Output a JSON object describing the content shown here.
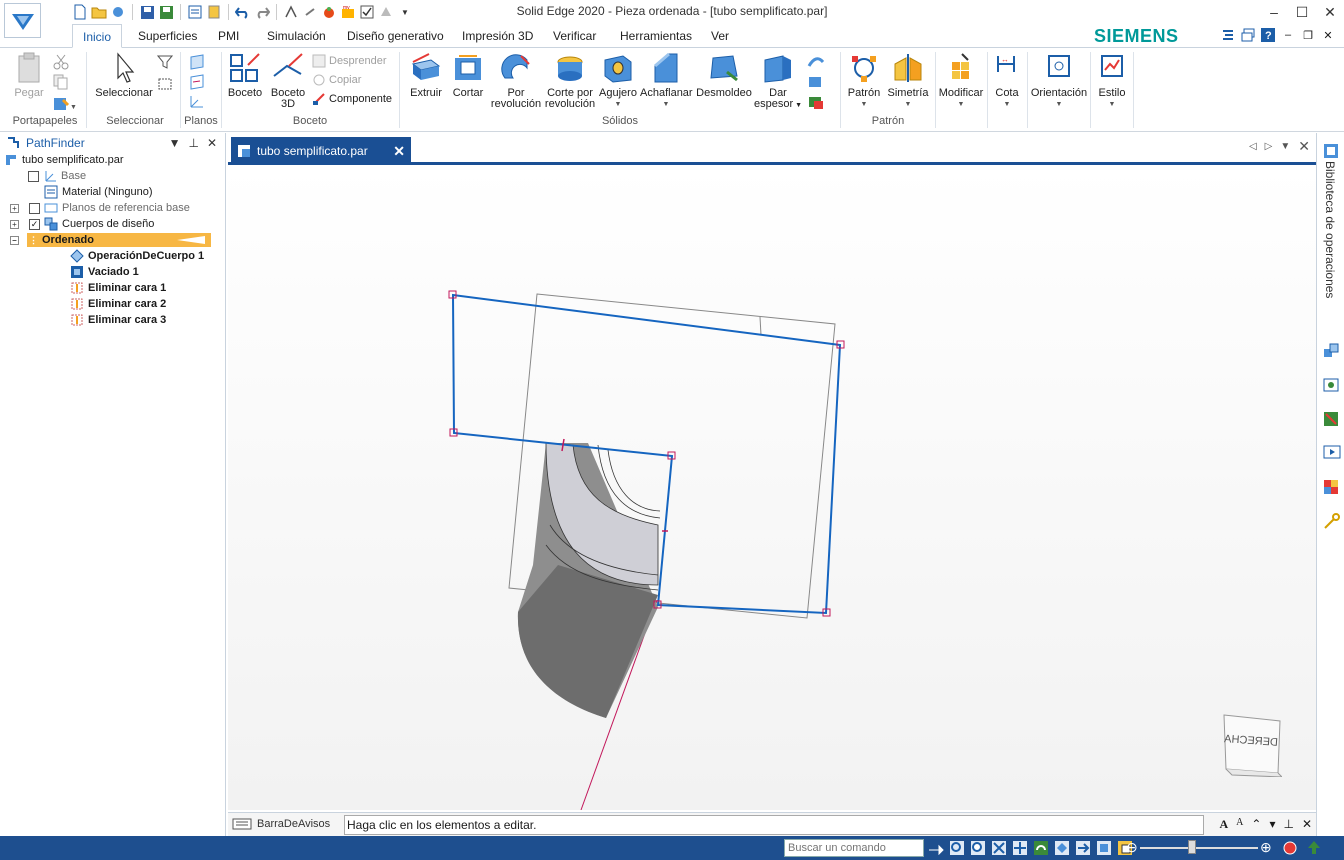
{
  "window": {
    "title": "Solid Edge 2020 - Pieza ordenada - [tubo semplificato.par]"
  },
  "ribbon_tabs": [
    "Inicio",
    "Superficies",
    "PMI",
    "Simulación",
    "Diseño generativo",
    "Impresión 3D",
    "Verificar",
    "Herramientas",
    "Ver"
  ],
  "active_tab": "Inicio",
  "brand": "SIEMENS",
  "ribbon": {
    "portapapeles": {
      "paste": "Pegar",
      "group": "Portapapeles"
    },
    "seleccionar": {
      "select": "Seleccionar",
      "group": "Seleccionar"
    },
    "planos": {
      "group": "Planos"
    },
    "boceto": {
      "sketch": "Boceto",
      "sketch3d_line1": "Boceto",
      "sketch3d_line2": "3D",
      "detach": "Desprender",
      "copy": "Copiar",
      "component": "Componente",
      "group": "Boceto"
    },
    "solidos": {
      "extrude": "Extruir",
      "cut": "Cortar",
      "revolve_line1": "Por",
      "revolve_line2": "revolución",
      "revcut_line1": "Corte por",
      "revcut_line2": "revolución",
      "hole": "Agujero",
      "chamfer": "Achaflanar",
      "draft": "Desmoldeo",
      "thicken_line1": "Dar",
      "thicken_line2": "espesor",
      "group": "Sólidos"
    },
    "patron": {
      "pattern": "Patrón",
      "mirror": "Simetría",
      "group": "Patrón"
    },
    "modify": "Modificar",
    "dimension": "Cota",
    "orientation": "Orientación",
    "style": "Estilo"
  },
  "pathfinder": {
    "title": "PathFinder",
    "root": "tubo semplificato.par",
    "items": [
      {
        "label": "Base",
        "gray": true
      },
      {
        "label": "Material (Ninguno)",
        "gray": false
      },
      {
        "label": "Planos de referencia base",
        "gray": true
      },
      {
        "label": "Cuerpos de diseño",
        "gray": false
      },
      {
        "label": "Ordenado",
        "gray": false
      }
    ],
    "features": [
      "OperaciónDeCuerpo 1",
      "Vaciado 1",
      "Eliminar cara 1",
      "Eliminar cara 2",
      "Eliminar cara 3"
    ]
  },
  "document_tab": "tubo semplificato.par",
  "right_panel_label": "Biblioteca de operaciones",
  "view_cube_label": "DERECHA",
  "infobar": {
    "label": "BarraDeAvisos",
    "message": "Haga clic en los elementos a editar."
  },
  "statusbar": {
    "search_placeholder": "Buscar un comando"
  },
  "colors": {
    "accent": "#1a4f94",
    "brand": "#009999",
    "sketch_blue": "#1565c0",
    "handle_magenta": "#c2185b"
  }
}
